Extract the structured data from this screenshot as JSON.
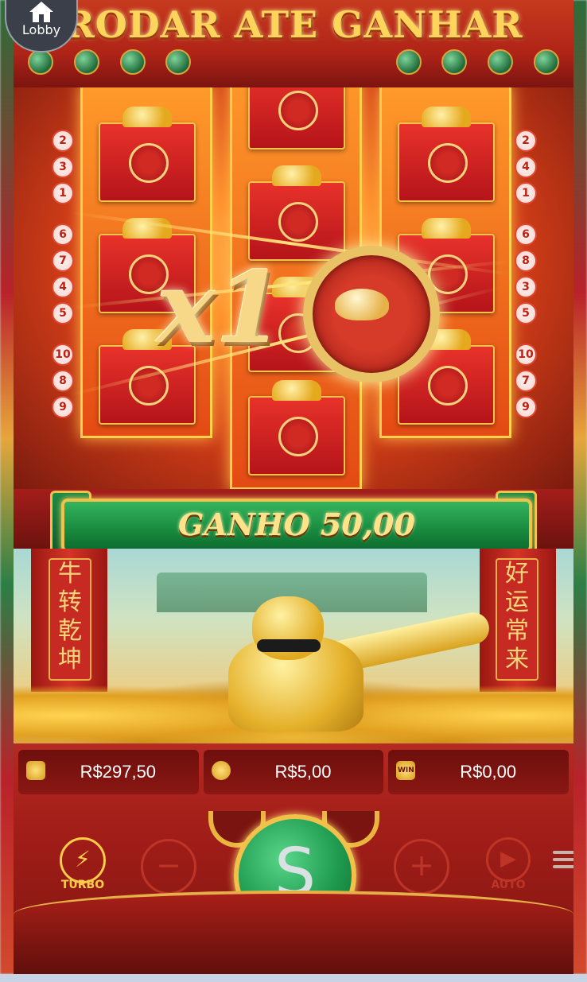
{
  "lobby": {
    "label": "Lobby"
  },
  "title": "RODAR ATE GANHAR",
  "ways": {
    "left": [
      "2",
      "3",
      "1",
      "6",
      "7",
      "4",
      "5",
      "10",
      "8",
      "9"
    ],
    "right": [
      "2",
      "4",
      "1",
      "6",
      "8",
      "3",
      "5",
      "10",
      "7",
      "9"
    ]
  },
  "multiplier": {
    "text": "x1"
  },
  "win": {
    "label": "GANHO 50,00"
  },
  "scrolls": {
    "left": "牛转乾坤",
    "right": "好运常来"
  },
  "info": {
    "balance": "R$297,50",
    "bet": "R$5,00",
    "win": "R$0,00",
    "win_icon": "WIN"
  },
  "controls": {
    "turbo": "TURBO",
    "auto": "AUTO",
    "minus": "−",
    "plus": "+",
    "turbo_glyph": "⚡",
    "auto_glyph": "▶",
    "spin_glyph": "S"
  },
  "colors": {
    "accent": "#f1c24a",
    "green": "#1f9a4e",
    "red": "#b52a22"
  }
}
